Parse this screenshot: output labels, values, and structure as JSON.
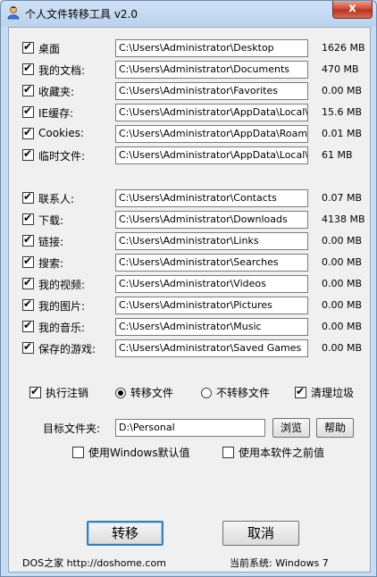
{
  "window": {
    "title": "个人文件转移工具 v2.0",
    "close_glyph": "x"
  },
  "folders_group1": [
    {
      "label": "桌面",
      "path": "C:\\Users\\Administrator\\Desktop",
      "size": "1626 MB",
      "checked": true
    },
    {
      "label": "我的文档:",
      "path": "C:\\Users\\Administrator\\Documents",
      "size": "470  MB",
      "checked": true
    },
    {
      "label": "收藏夹:",
      "path": "C:\\Users\\Administrator\\Favorites",
      "size": "0.00 MB",
      "checked": true
    },
    {
      "label": "IE缓存:",
      "path": "C:\\Users\\Administrator\\AppData\\Local\\Micro",
      "size": "15.6 MB",
      "checked": true
    },
    {
      "label": "Cookies:",
      "path": "C:\\Users\\Administrator\\AppData\\Roaming\\M",
      "size": "0.01 MB",
      "checked": true
    },
    {
      "label": "临时文件:",
      "path": "C:\\Users\\Administrator\\AppData\\Local\\Temp",
      "size": "61  MB",
      "checked": true
    }
  ],
  "folders_group2": [
    {
      "label": "联系人:",
      "path": "C:\\Users\\Administrator\\Contacts",
      "size": "0.07 MB",
      "checked": true
    },
    {
      "label": "下载:",
      "path": "C:\\Users\\Administrator\\Downloads",
      "size": "4138 MB",
      "checked": true
    },
    {
      "label": "链接:",
      "path": "C:\\Users\\Administrator\\Links",
      "size": "0.00 MB",
      "checked": true
    },
    {
      "label": "搜索:",
      "path": "C:\\Users\\Administrator\\Searches",
      "size": "0.00 MB",
      "checked": true
    },
    {
      "label": "我的视频:",
      "path": "C:\\Users\\Administrator\\Videos",
      "size": "0.00 MB",
      "checked": true
    },
    {
      "label": "我的图片:",
      "path": "C:\\Users\\Administrator\\Pictures",
      "size": "0.00 MB",
      "checked": true
    },
    {
      "label": "我的音乐:",
      "path": "C:\\Users\\Administrator\\Music",
      "size": "0.00 MB",
      "checked": true
    },
    {
      "label": "保存的游戏:",
      "path": "C:\\Users\\Administrator\\Saved Games",
      "size": "0.00 MB",
      "checked": true
    }
  ],
  "options": {
    "logoff_label": "执行注销",
    "move_label": "转移文件",
    "nomove_label": "不转移文件",
    "clean_label": "清理垃圾"
  },
  "target": {
    "label": "目标文件夹:",
    "value": "D:\\Personal",
    "browse_label": "浏览",
    "help_label": "帮助"
  },
  "defaults": {
    "windows_default_label": "使用Windows默认值",
    "previous_label": "使用本软件之前值"
  },
  "actions": {
    "transfer_label": "转移",
    "cancel_label": "取消"
  },
  "footer": {
    "site": "DOS之家  http://doshome.com",
    "system": "当前系统:  Windows 7"
  }
}
